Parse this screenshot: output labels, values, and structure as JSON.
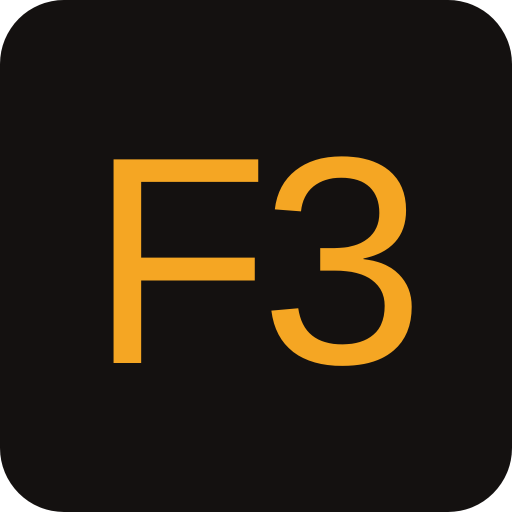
{
  "key": {
    "label": "F3",
    "background_color": "#141110",
    "text_color": "#f5a623"
  }
}
